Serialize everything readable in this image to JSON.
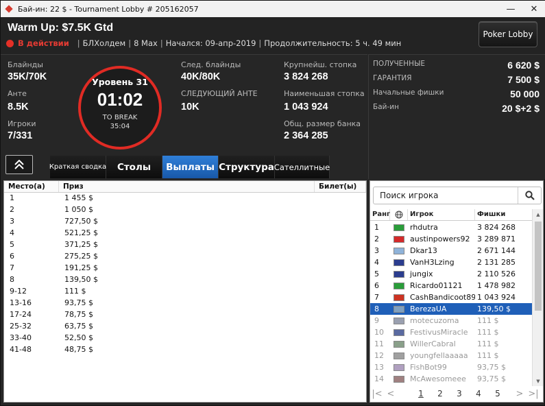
{
  "window": {
    "title": "Бай-ин: 22 $ - Tournament Lobby # 205162057",
    "minimize": "—",
    "close": "✕"
  },
  "header": {
    "event_title": "Warm Up: $7.5K Gtd",
    "status": "В действии",
    "game": "БЛХолдем",
    "table_size": "8 Max",
    "started": "Начался: 09-апр-2019",
    "duration": "Продолжительность: 5 ч. 49 мин",
    "lobby_button": "Poker Lobby"
  },
  "stats": {
    "blinds_label": "Блайнды",
    "blinds_value": "35K/70K",
    "ante_label": "Анте",
    "ante_value": "8.5K",
    "players_label": "Игроки",
    "players_value": "7/331",
    "next_blinds_label": "След. блайнды",
    "next_blinds_value": "40K/80K",
    "next_ante_label": "СЛЕДУЮЩИЙ АНТЕ",
    "next_ante_value": "10K",
    "largest_label": "Крупнейш. стопка",
    "largest_value": "3 824 268",
    "smallest_label": "Наименьшая стопка",
    "smallest_value": "1 043 924",
    "total_label": "Общ. размер банка",
    "total_value": "2 364 285"
  },
  "level": {
    "title": "Уровень 31",
    "clock": "01:02",
    "break_label": "TO BREAK",
    "break_time": "35:04"
  },
  "tabs": [
    {
      "label": "Краткая сводка"
    },
    {
      "label": "Столы"
    },
    {
      "label": "Выплаты"
    },
    {
      "label": "Структура"
    },
    {
      "label": "Сателлитные"
    }
  ],
  "prize_info": {
    "received_label": "ПОЛУЧЕННЫЕ",
    "received_value": "6 620 $",
    "guarantee_label": "ГАРАНТИЯ",
    "guarantee_value": "7 500 $",
    "starting_chips_label": "Начальные фишки",
    "starting_chips_value": "50 000",
    "buyin_label": "Бай-ин",
    "buyin_value": "20 $+2 $"
  },
  "payouts": {
    "headers": {
      "place": "Место(а)",
      "prize": "Приз",
      "ticket": "Билет(ы)"
    },
    "rows": [
      {
        "place": "1",
        "prize": "1 455 $"
      },
      {
        "place": "2",
        "prize": "1 050 $"
      },
      {
        "place": "3",
        "prize": "727,50 $"
      },
      {
        "place": "4",
        "prize": "521,25 $"
      },
      {
        "place": "5",
        "prize": "371,25 $"
      },
      {
        "place": "6",
        "prize": "275,25 $"
      },
      {
        "place": "7",
        "prize": "191,25 $"
      },
      {
        "place": "8",
        "prize": "139,50 $"
      },
      {
        "place": "9-12",
        "prize": "111 $"
      },
      {
        "place": "13-16",
        "prize": "93,75 $"
      },
      {
        "place": "17-24",
        "prize": "78,75 $"
      },
      {
        "place": "25-32",
        "prize": "63,75 $"
      },
      {
        "place": "33-40",
        "prize": "52,50 $"
      },
      {
        "place": "41-48",
        "prize": "48,75 $"
      }
    ]
  },
  "players": {
    "search_placeholder": "Поиск игрока",
    "headers": {
      "rank": "Ранг",
      "name": "Игрок",
      "chips": "Фишки"
    },
    "rows": [
      {
        "rank": "1",
        "name": "rhdutra",
        "chips": "3 824 268",
        "flag": "#2a9d3a"
      },
      {
        "rank": "2",
        "name": "austinpowers92",
        "chips": "3 289 871",
        "flag": "#d42a2a"
      },
      {
        "rank": "3",
        "name": "Dkar13",
        "chips": "2 671 144",
        "flag": "#8fb3d9"
      },
      {
        "rank": "4",
        "name": "VanH3Lzing",
        "chips": "2 131 285",
        "flag": "#2b3d8f"
      },
      {
        "rank": "5",
        "name": "jungix",
        "chips": "2 110 526",
        "flag": "#2b3d8f"
      },
      {
        "rank": "6",
        "name": "Ricardo01121",
        "chips": "1 478 982",
        "flag": "#2a9d3a"
      },
      {
        "rank": "7",
        "name": "CashBandicoot89",
        "chips": "1 043 924",
        "flag": "#cc3322"
      },
      {
        "rank": "8",
        "name": "BerezaUA",
        "chips": "139,50 $",
        "flag": "#7fa0c0"
      },
      {
        "rank": "9",
        "name": "motecuzoma",
        "chips": "111 $",
        "flag": "#9aa0b0"
      },
      {
        "rank": "10",
        "name": "FestivusMiracle",
        "chips": "111 $",
        "flag": "#5a6aa0"
      },
      {
        "rank": "11",
        "name": "WillerCabral",
        "chips": "111 $",
        "flag": "#8aa08a"
      },
      {
        "rank": "12",
        "name": "youngfellaaaaa",
        "chips": "111 $",
        "flag": "#a0a0a0"
      },
      {
        "rank": "13",
        "name": "FishBot99",
        "chips": "93,75 $",
        "flag": "#b0a0c0"
      },
      {
        "rank": "14",
        "name": "McAwesomeee",
        "chips": "93,75 $",
        "flag": "#a08080"
      }
    ],
    "pages": [
      "1",
      "2",
      "3",
      "4",
      "5"
    ]
  }
}
